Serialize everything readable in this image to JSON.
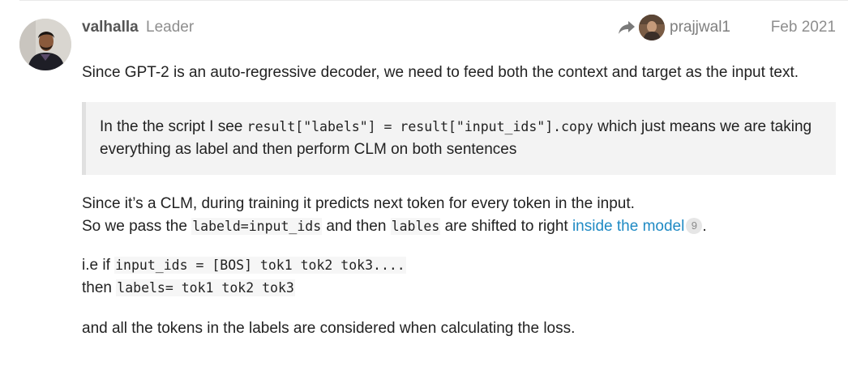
{
  "post": {
    "username": "valhalla",
    "user_title": "Leader",
    "reply_to_user": "prajjwal1",
    "date": "Feb 2021"
  },
  "content": {
    "p1": "Since GPT-2 is an auto-regressive decoder, we need to feed both the context and target as the input text.",
    "quote": {
      "pre": "In the the script I see ",
      "code": "result[\"labels\"] = result[\"input_ids\"].copy",
      "post": " which just means we are taking everything as label and then perform CLM on both sentences"
    },
    "p2": {
      "line1": "Since it’s a CLM, during training it predicts next token for every token in the input.",
      "l2_pre": "So we pass the ",
      "l2_code1": "labeld=input_ids",
      "l2_mid": " and then ",
      "l2_code2": "lables",
      "l2_post": " are shifted to right ",
      "link_text": "inside the model",
      "link_count": "9",
      "l2_end": "."
    },
    "p3": {
      "l1_pre": "i.e if ",
      "l1_code": "input_ids = [BOS] tok1 tok2 tok3....",
      "l2_pre": "then ",
      "l2_code": "labels= tok1 tok2 tok3"
    },
    "p4": "and all the tokens in the labels are considered when calculating the loss."
  },
  "colors": {
    "link": "#1f8ac4",
    "quote_bg": "#f3f3f3",
    "quote_border": "#e0e0e0"
  }
}
